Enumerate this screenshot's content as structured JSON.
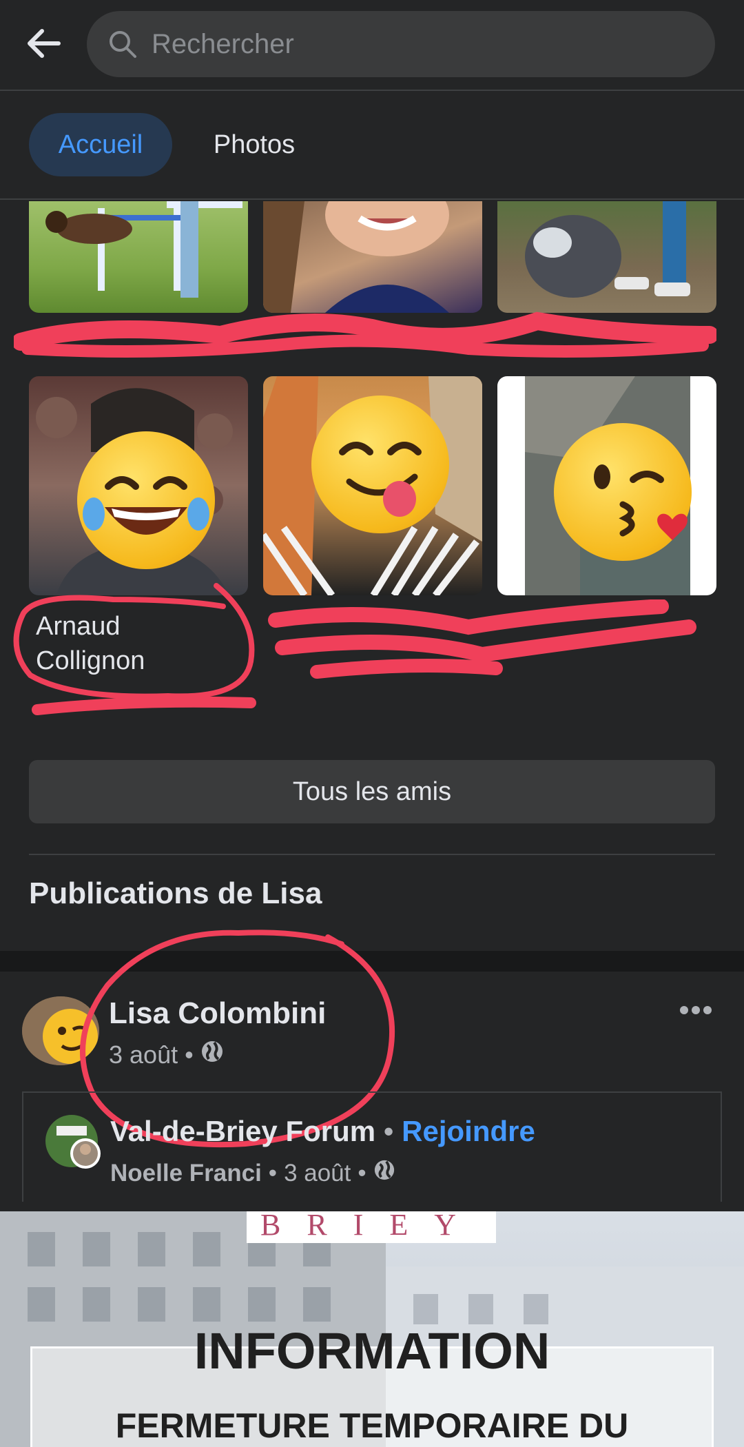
{
  "header": {
    "search_placeholder": "Rechercher"
  },
  "tabs": [
    {
      "label": "Accueil",
      "active": true
    },
    {
      "label": "Photos",
      "active": false
    }
  ],
  "friends": {
    "visible_name_line1": "Arnaud",
    "visible_name_line2": "Collignon",
    "all_friends_label": "Tous les amis"
  },
  "section_title": "Publications de Lisa",
  "post": {
    "author": "Lisa Colombini",
    "date": "3 août",
    "shared": {
      "group_name": "Val-de-Briey Forum",
      "join_label": "Rejoindre",
      "poster": "Noelle Franci",
      "date": "3 août"
    },
    "image": {
      "brand": "BRIEY",
      "title": "INFORMATION",
      "subtitle": "FERMETURE TEMPORAIRE DU"
    }
  },
  "colors": {
    "accent": "#4599ff",
    "annotation": "#f0405a",
    "background": "#242526"
  }
}
